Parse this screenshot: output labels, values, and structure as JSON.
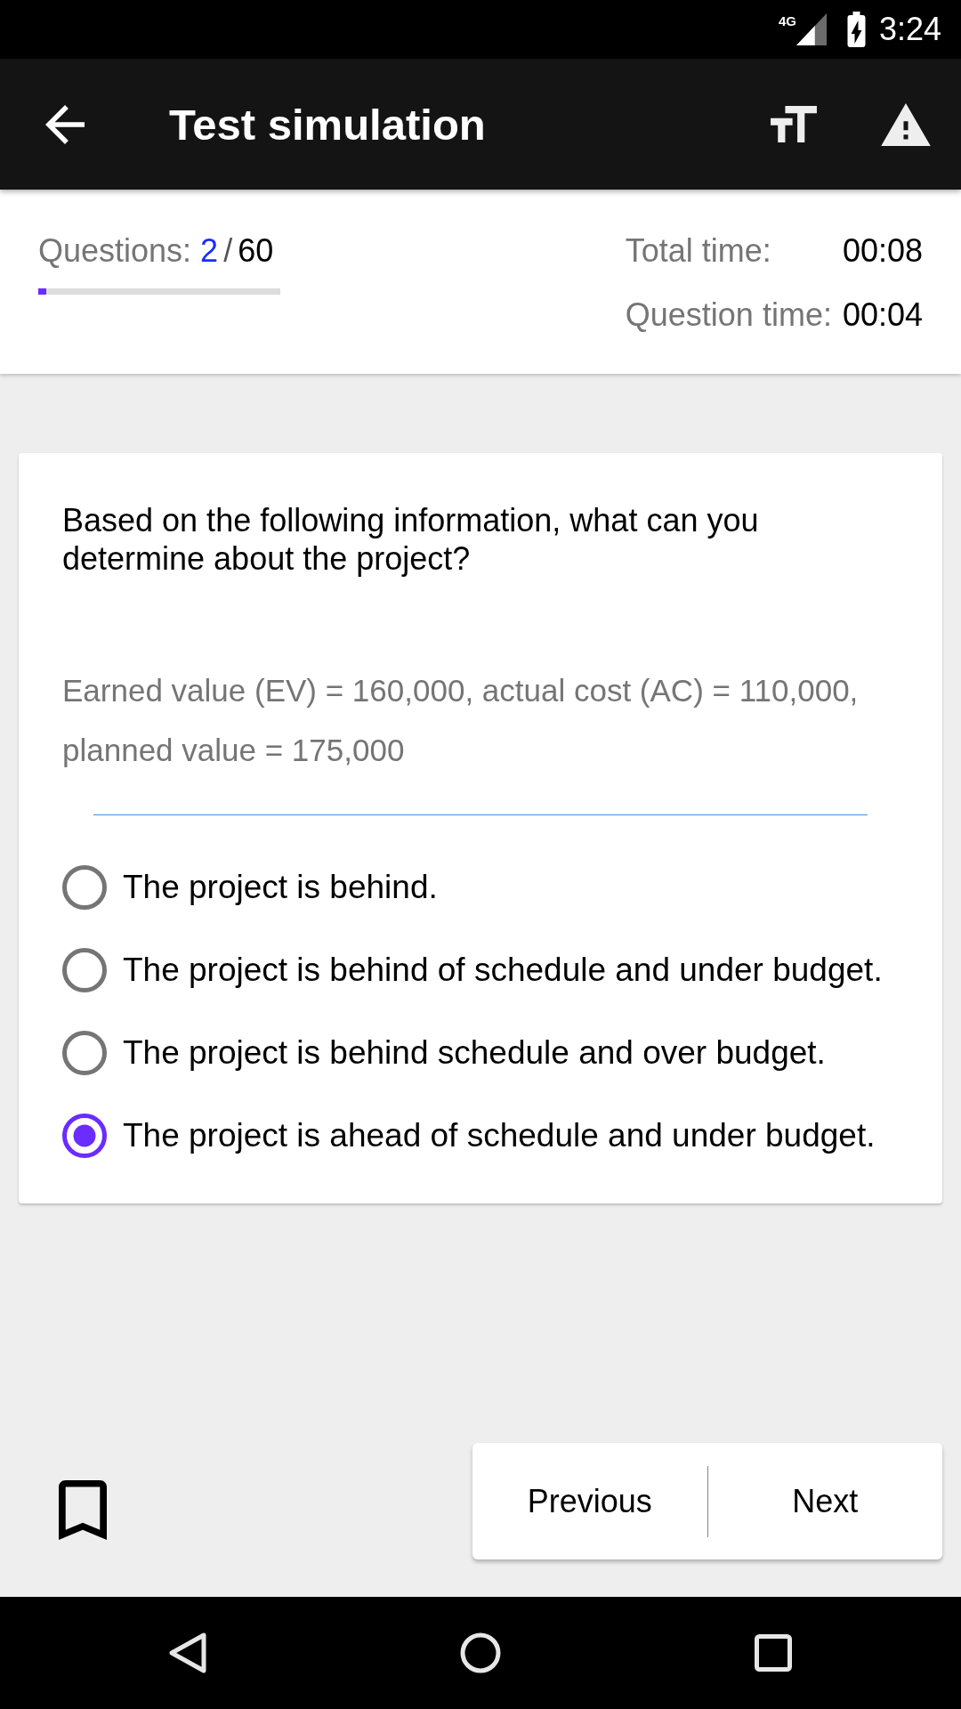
{
  "status_bar": {
    "network": "4G",
    "time": "3:24"
  },
  "toolbar": {
    "title": "Test simulation"
  },
  "progress": {
    "label": "Questions:",
    "current": "2",
    "separator": "/",
    "total": "60",
    "level": 0.033,
    "total_time_label": "Total time:",
    "total_time": "00:08",
    "question_time_label": "Question time:",
    "question_time": "00:04"
  },
  "question": {
    "text": "Based on the following information, what can you determine about the project?",
    "info": "Earned value (EV) = 160,000, actual cost (AC) = 110,000, planned value = 175,000",
    "options": [
      {
        "label": "The project is behind.",
        "selected": false
      },
      {
        "label": "The project is behind of schedule and under budget.",
        "selected": false
      },
      {
        "label": "The project is behind schedule and over budget.",
        "selected": false
      },
      {
        "label": "The project is ahead of schedule and under budget.",
        "selected": true
      }
    ]
  },
  "navigation": {
    "previous": "Previous",
    "next": "Next"
  }
}
